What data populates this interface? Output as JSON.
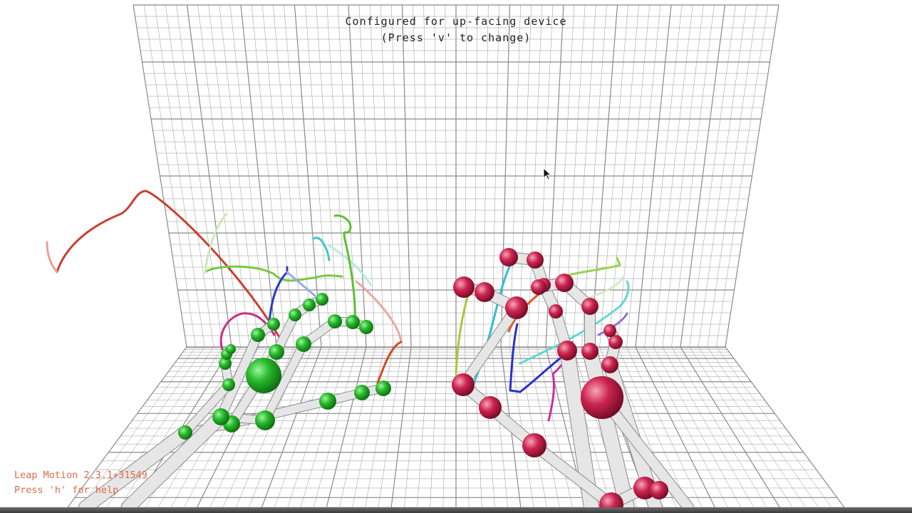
{
  "viewer": {
    "config_message": "Configured for up-facing device",
    "config_hint": "(Press 'v' to change)",
    "version": "Leap Motion 2.3.1+31549",
    "help_hint": "Press 'h' for help"
  },
  "colors": {
    "grid": "#8a8a8a",
    "left_hand_joint": "#22b022",
    "right_hand_joint": "#c8204a",
    "bone": "#dcdcdc",
    "status_text": "#e06a4a"
  },
  "icons": {
    "cursor": "arrow-pointer-icon"
  }
}
